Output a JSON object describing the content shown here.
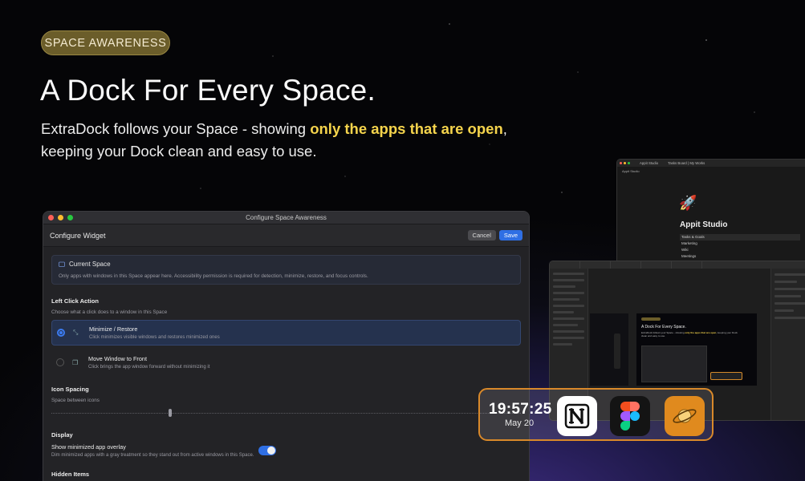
{
  "badge": "SPACE AWARENESS",
  "hero": {
    "title": "A Dock For Every Space.",
    "subtitle_pre": "ExtraDock follows your Space - showing ",
    "subtitle_highlight": "only the apps that are open",
    "subtitle_post": ",",
    "subtitle_line2": "keeping your Dock clean and easy to use."
  },
  "colors": {
    "accent_yellow": "#f5d44c",
    "badge_bg": "#6b5d2a",
    "dock_border": "#d9892a",
    "primary_blue": "#2f6fe4"
  },
  "config_window": {
    "title": "Configure Space Awareness",
    "header": "Configure Widget",
    "cancel": "Cancel",
    "save": "Save",
    "current_space": {
      "title": "Current Space",
      "description": "Only apps with windows in this Space appear here. Accessibility permission is required for detection, minimize, restore, and focus controls."
    },
    "left_click": {
      "title": "Left Click Action",
      "description": "Choose what a click does to a window in this Space",
      "options": [
        {
          "label": "Minimize / Restore",
          "description": "Click minimizes visible windows and restores minimized ones",
          "selected": true
        },
        {
          "label": "Move Window to Front",
          "description": "Click brings the app window forward without minimizing it",
          "selected": false
        }
      ]
    },
    "icon_spacing": {
      "title": "Icon Spacing",
      "label": "Space between icons"
    },
    "display": {
      "title": "Display",
      "label": "Show minimized app overlay",
      "description": "Dim minimized apps with a gray treatment so they stand out from active windows in this Space.",
      "enabled": true
    },
    "hidden_items": {
      "title": "Hidden Items"
    }
  },
  "notion_window": {
    "tabs": [
      "Appit Studio",
      "Tasks Board | My Works"
    ],
    "breadcrumb": "Appit Studio",
    "page_title": "Appit Studio",
    "items": [
      "Tasks & Goals",
      "Marketing",
      "Wiki",
      "Meetings"
    ]
  },
  "figma_window": {
    "preview_title": "A Dock For Every Space.",
    "preview_sub_pre": "ExtraDock follows your Space - showing ",
    "preview_sub_hl": "only the apps that are open",
    "preview_sub_post": ", keeping your Dock clean and easy to use."
  },
  "dock": {
    "time": "19:57:25",
    "date": "May 20",
    "apps": [
      {
        "name": "notion-icon"
      },
      {
        "name": "figma-icon"
      },
      {
        "name": "planet-icon"
      }
    ]
  }
}
